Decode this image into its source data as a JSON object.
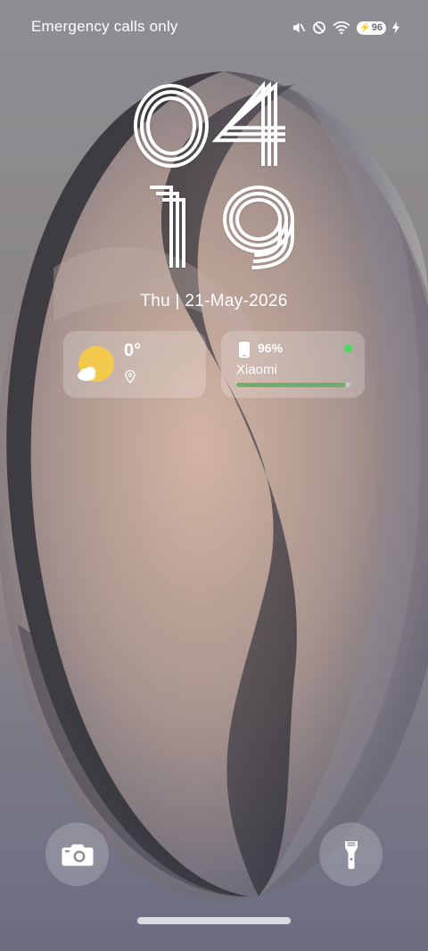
{
  "status_bar": {
    "carrier_text": "Emergency calls only",
    "battery_level": "96",
    "charging": true,
    "icons": [
      "vibrate-mute-icon",
      "do-not-disturb-icon",
      "wifi-icon",
      "battery-icon",
      "charging-bolt-icon"
    ]
  },
  "clock": {
    "hour": "04",
    "minute": "19"
  },
  "date": {
    "text": "Thu | 21-May-2026"
  },
  "weather_widget": {
    "temperature": "0°",
    "icon": "partly-cloudy-icon",
    "location_icon": "location-pin-icon"
  },
  "device_widget": {
    "battery_percent": "96%",
    "device_name": "Xiaomi",
    "battery_fraction": 0.96,
    "status_color": "#4cd964",
    "icon": "phone-icon"
  },
  "shortcuts": {
    "left_icon": "camera-icon",
    "right_icon": "flashlight-icon"
  },
  "colors": {
    "accent_sun": "#f2c94c",
    "battery_bar": "#6fae6a",
    "text": "#ffffff"
  }
}
